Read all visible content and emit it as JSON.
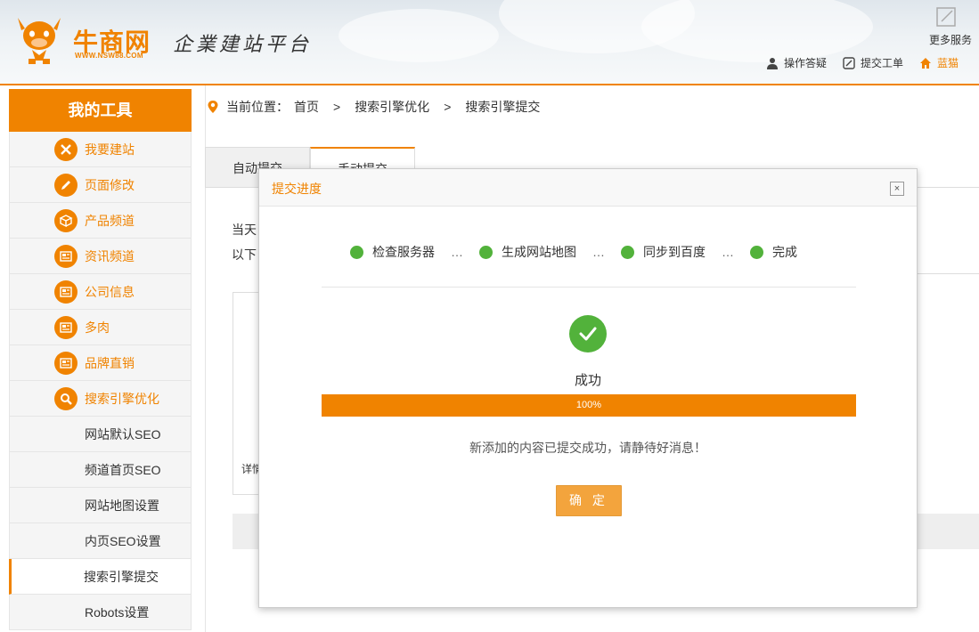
{
  "header": {
    "logo_name": "牛商网",
    "logo_url": "WWW.NSW88.COM",
    "slogan": "企業建站平台",
    "more_services": "更多服务",
    "links": [
      {
        "label": "操作答疑"
      },
      {
        "label": "提交工单"
      },
      {
        "label": "蓝猫"
      }
    ]
  },
  "sidebar": {
    "title": "我的工具",
    "items": [
      {
        "label": "我要建站",
        "icon": "tools-icon"
      },
      {
        "label": "页面修改",
        "icon": "pencil-icon"
      },
      {
        "label": "产品频道",
        "icon": "box-icon"
      },
      {
        "label": "资讯频道",
        "icon": "newspaper-icon"
      },
      {
        "label": "公司信息",
        "icon": "newspaper-icon"
      },
      {
        "label": "多肉",
        "icon": "newspaper-icon"
      },
      {
        "label": "品牌直销",
        "icon": "newspaper-icon"
      },
      {
        "label": "搜索引擎优化",
        "icon": "search-icon"
      }
    ],
    "sub_items": [
      {
        "label": "网站默认SEO"
      },
      {
        "label": "频道首页SEO"
      },
      {
        "label": "网站地图设置"
      },
      {
        "label": "内页SEO设置"
      },
      {
        "label": "搜索引擎提交"
      },
      {
        "label": "Robots设置"
      }
    ]
  },
  "breadcrumb": {
    "prefix": "当前位置：",
    "items": [
      "首页",
      "搜索引擎优化",
      "搜索引擎提交"
    ],
    "separator": ">"
  },
  "tabs": [
    {
      "label": "自动提交"
    },
    {
      "label": "手动提交"
    }
  ],
  "background": {
    "text1": "当天",
    "text2": "以下",
    "text3": "详情"
  },
  "modal": {
    "title": "提交进度",
    "close_symbol": "×",
    "steps": [
      {
        "label": "检查服务器"
      },
      {
        "label": "生成网站地图"
      },
      {
        "label": "同步到百度"
      },
      {
        "label": "完成"
      }
    ],
    "step_separator": "…",
    "status": "成功",
    "progress_label": "100%",
    "progress_value": 100,
    "message": "新添加的内容已提交成功，请静待好消息！",
    "confirm_label": "确 定"
  },
  "colors": {
    "accent": "#f08300",
    "success": "#52b23b",
    "button": "#f3a43d"
  }
}
